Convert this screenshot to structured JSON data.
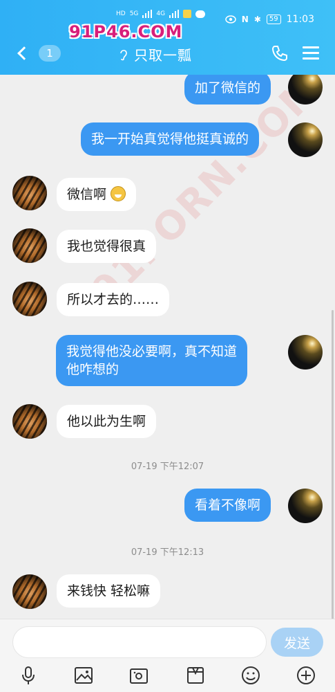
{
  "status": {
    "left_icons": [
      "HD",
      "5G",
      "HD",
      "4G"
    ],
    "battery": "59",
    "time": "11:03"
  },
  "watermark": {
    "top": "91P46.COM",
    "diagonal": "91PORN.COM"
  },
  "header": {
    "unread_count": "1",
    "title": "只取一瓢",
    "icons": [
      "back-chevron-icon",
      "ear-icon",
      "phone-icon",
      "menu-icon"
    ]
  },
  "messages": [
    {
      "side": "out",
      "text": "加了微信的"
    },
    {
      "side": "out",
      "text": "我一开始真觉得他挺真诚的"
    },
    {
      "side": "in",
      "text": "微信啊",
      "emoji": "grinning-face"
    },
    {
      "side": "in",
      "text": "我也觉得很真"
    },
    {
      "side": "in",
      "text": "所以才去的……"
    },
    {
      "side": "out",
      "text": "我觉得他没必要啊，真不知道",
      "text2": "他咋想的"
    },
    {
      "side": "in",
      "text": "他以此为生啊"
    },
    {
      "timestamp": "07-19 下午12:07"
    },
    {
      "side": "out",
      "text": "看着不像啊"
    },
    {
      "timestamp": "07-19 下午12:13"
    },
    {
      "side": "in",
      "text": "来钱快 轻松嘛"
    }
  ],
  "input": {
    "value": "",
    "placeholder": ""
  },
  "send_label": "发送",
  "toolbar": [
    "microphone-icon",
    "image-icon",
    "camera-icon",
    "folder-icon",
    "emoji-icon",
    "plus-icon"
  ],
  "colors": {
    "header": "#2fb0f5",
    "bubble_out": "#3b98f2",
    "bubble_in": "#ffffff",
    "send_disabled": "#a9d2f5"
  }
}
